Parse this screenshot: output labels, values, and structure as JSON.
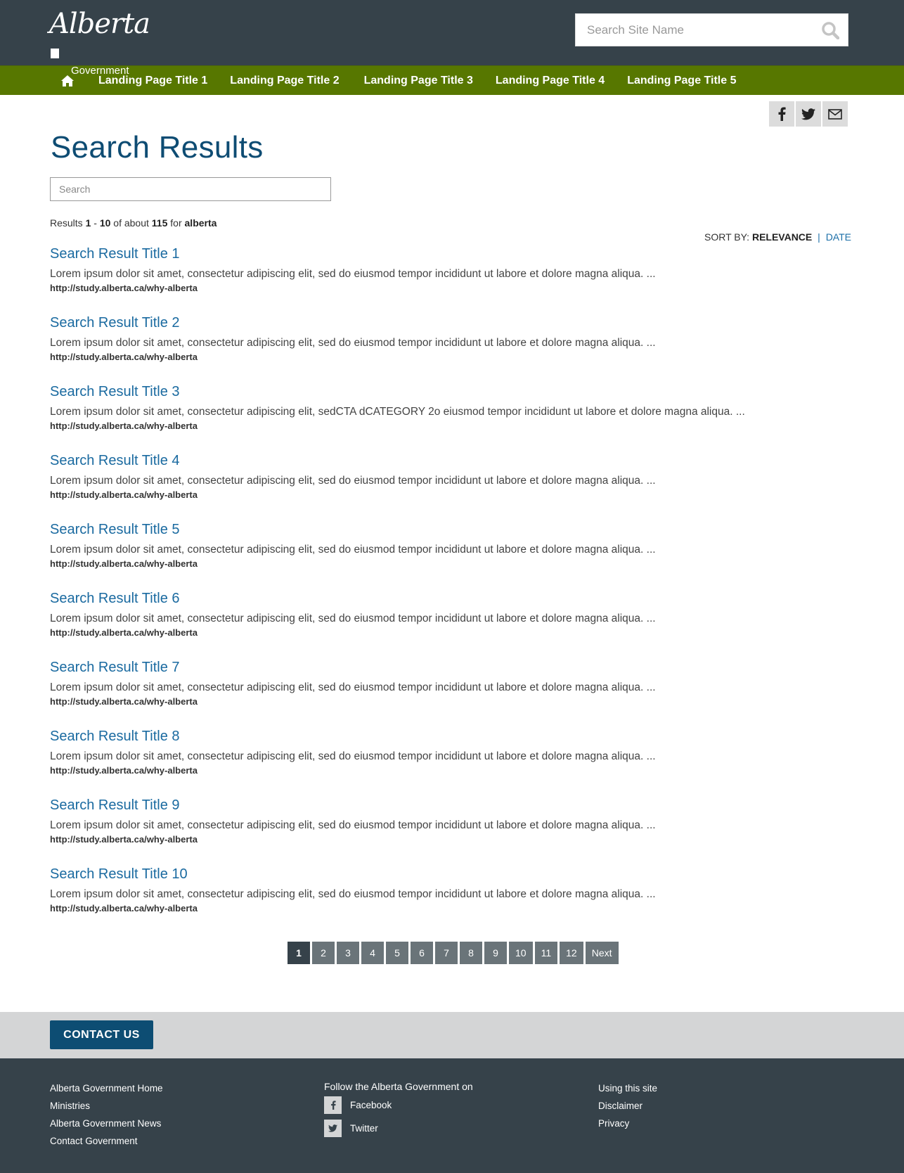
{
  "header": {
    "logo_script": "Alberta",
    "logo_sub": "Government",
    "search_placeholder": "Search Site Name"
  },
  "nav": {
    "items": [
      {
        "label": "Landing Page Title 1"
      },
      {
        "label": "Landing Page Title 2"
      },
      {
        "label": "Landing Page Title 3"
      },
      {
        "label": "Landing Page Title 4"
      },
      {
        "label": "Landing Page Title 5"
      }
    ]
  },
  "page": {
    "title": "Search Results",
    "search_placeholder": "Search"
  },
  "summary": {
    "prefix": "Results",
    "from": "1",
    "dash": "-",
    "to": "10",
    "of_about": "of about",
    "total": "115",
    "for": "for",
    "query": "alberta"
  },
  "sort": {
    "label": "SORT BY:",
    "active": "RELEVANCE",
    "separator": "|",
    "other": "DATE"
  },
  "results": [
    {
      "title": "Search Result Title 1",
      "desc": "Lorem ipsum dolor sit amet, consectetur adipiscing elit, sed do eiusmod tempor incididunt ut labore et dolore magna aliqua. ...",
      "url": "http://study.alberta.ca/why-alberta"
    },
    {
      "title": "Search Result Title 2",
      "desc": "Lorem ipsum dolor sit amet, consectetur adipiscing elit, sed do eiusmod tempor incididunt ut labore et dolore magna aliqua. ...",
      "url": "http://study.alberta.ca/why-alberta"
    },
    {
      "title": "Search Result Title 3",
      "desc": "Lorem ipsum dolor sit amet, consectetur adipiscing elit, sedCTA dCATEGORY 2o eiusmod tempor incididunt ut labore et dolore magna aliqua. ...",
      "url": "http://study.alberta.ca/why-alberta"
    },
    {
      "title": "Search Result Title 4",
      "desc": "Lorem ipsum dolor sit amet, consectetur adipiscing elit, sed do eiusmod tempor incididunt ut labore et dolore magna aliqua. ...",
      "url": "http://study.alberta.ca/why-alberta"
    },
    {
      "title": "Search Result Title 5",
      "desc": "Lorem ipsum dolor sit amet, consectetur adipiscing elit, sed do eiusmod tempor incididunt ut labore et dolore magna aliqua. ...",
      "url": "http://study.alberta.ca/why-alberta"
    },
    {
      "title": "Search Result Title 6",
      "desc": "Lorem ipsum dolor sit amet, consectetur adipiscing elit, sed do eiusmod tempor incididunt ut labore et dolore magna aliqua. ...",
      "url": "http://study.alberta.ca/why-alberta"
    },
    {
      "title": "Search Result Title 7",
      "desc": "Lorem ipsum dolor sit amet, consectetur adipiscing elit, sed do eiusmod tempor incididunt ut labore et dolore magna aliqua. ...",
      "url": "http://study.alberta.ca/why-alberta"
    },
    {
      "title": "Search Result Title 8",
      "desc": "Lorem ipsum dolor sit amet, consectetur adipiscing elit, sed do eiusmod tempor incididunt ut labore et dolore magna aliqua. ...",
      "url": "http://study.alberta.ca/why-alberta"
    },
    {
      "title": "Search Result Title 9",
      "desc": "Lorem ipsum dolor sit amet, consectetur adipiscing elit, sed do eiusmod tempor incididunt ut labore et dolore magna aliqua. ...",
      "url": "http://study.alberta.ca/why-alberta"
    },
    {
      "title": "Search Result Title 10",
      "desc": "Lorem ipsum dolor sit amet, consectetur adipiscing elit, sed do eiusmod tempor incididunt ut labore et dolore magna aliqua. ...",
      "url": "http://study.alberta.ca/why-alberta"
    }
  ],
  "pager": {
    "pages": [
      "1",
      "2",
      "3",
      "4",
      "5",
      "6",
      "7",
      "8",
      "9",
      "10",
      "11",
      "12"
    ],
    "current": "1",
    "next": "Next"
  },
  "contact": {
    "label": "CONTACT US"
  },
  "footer": {
    "col1": [
      "Alberta Government Home",
      "Ministries",
      "Alberta Government News",
      "Contact Government"
    ],
    "follow_label": "Follow the Alberta Government on",
    "social": [
      {
        "label": "Facebook",
        "icon": "facebook-icon"
      },
      {
        "label": "Twitter",
        "icon": "twitter-icon"
      }
    ],
    "col3": [
      "Using this site",
      "Disclaimer",
      "Privacy"
    ]
  },
  "colors": {
    "header_bg": "#36424a",
    "nav_bg": "#577700",
    "title": "#0e4c73",
    "link": "#1a6aa0",
    "contact_btn": "#0d4d73"
  }
}
